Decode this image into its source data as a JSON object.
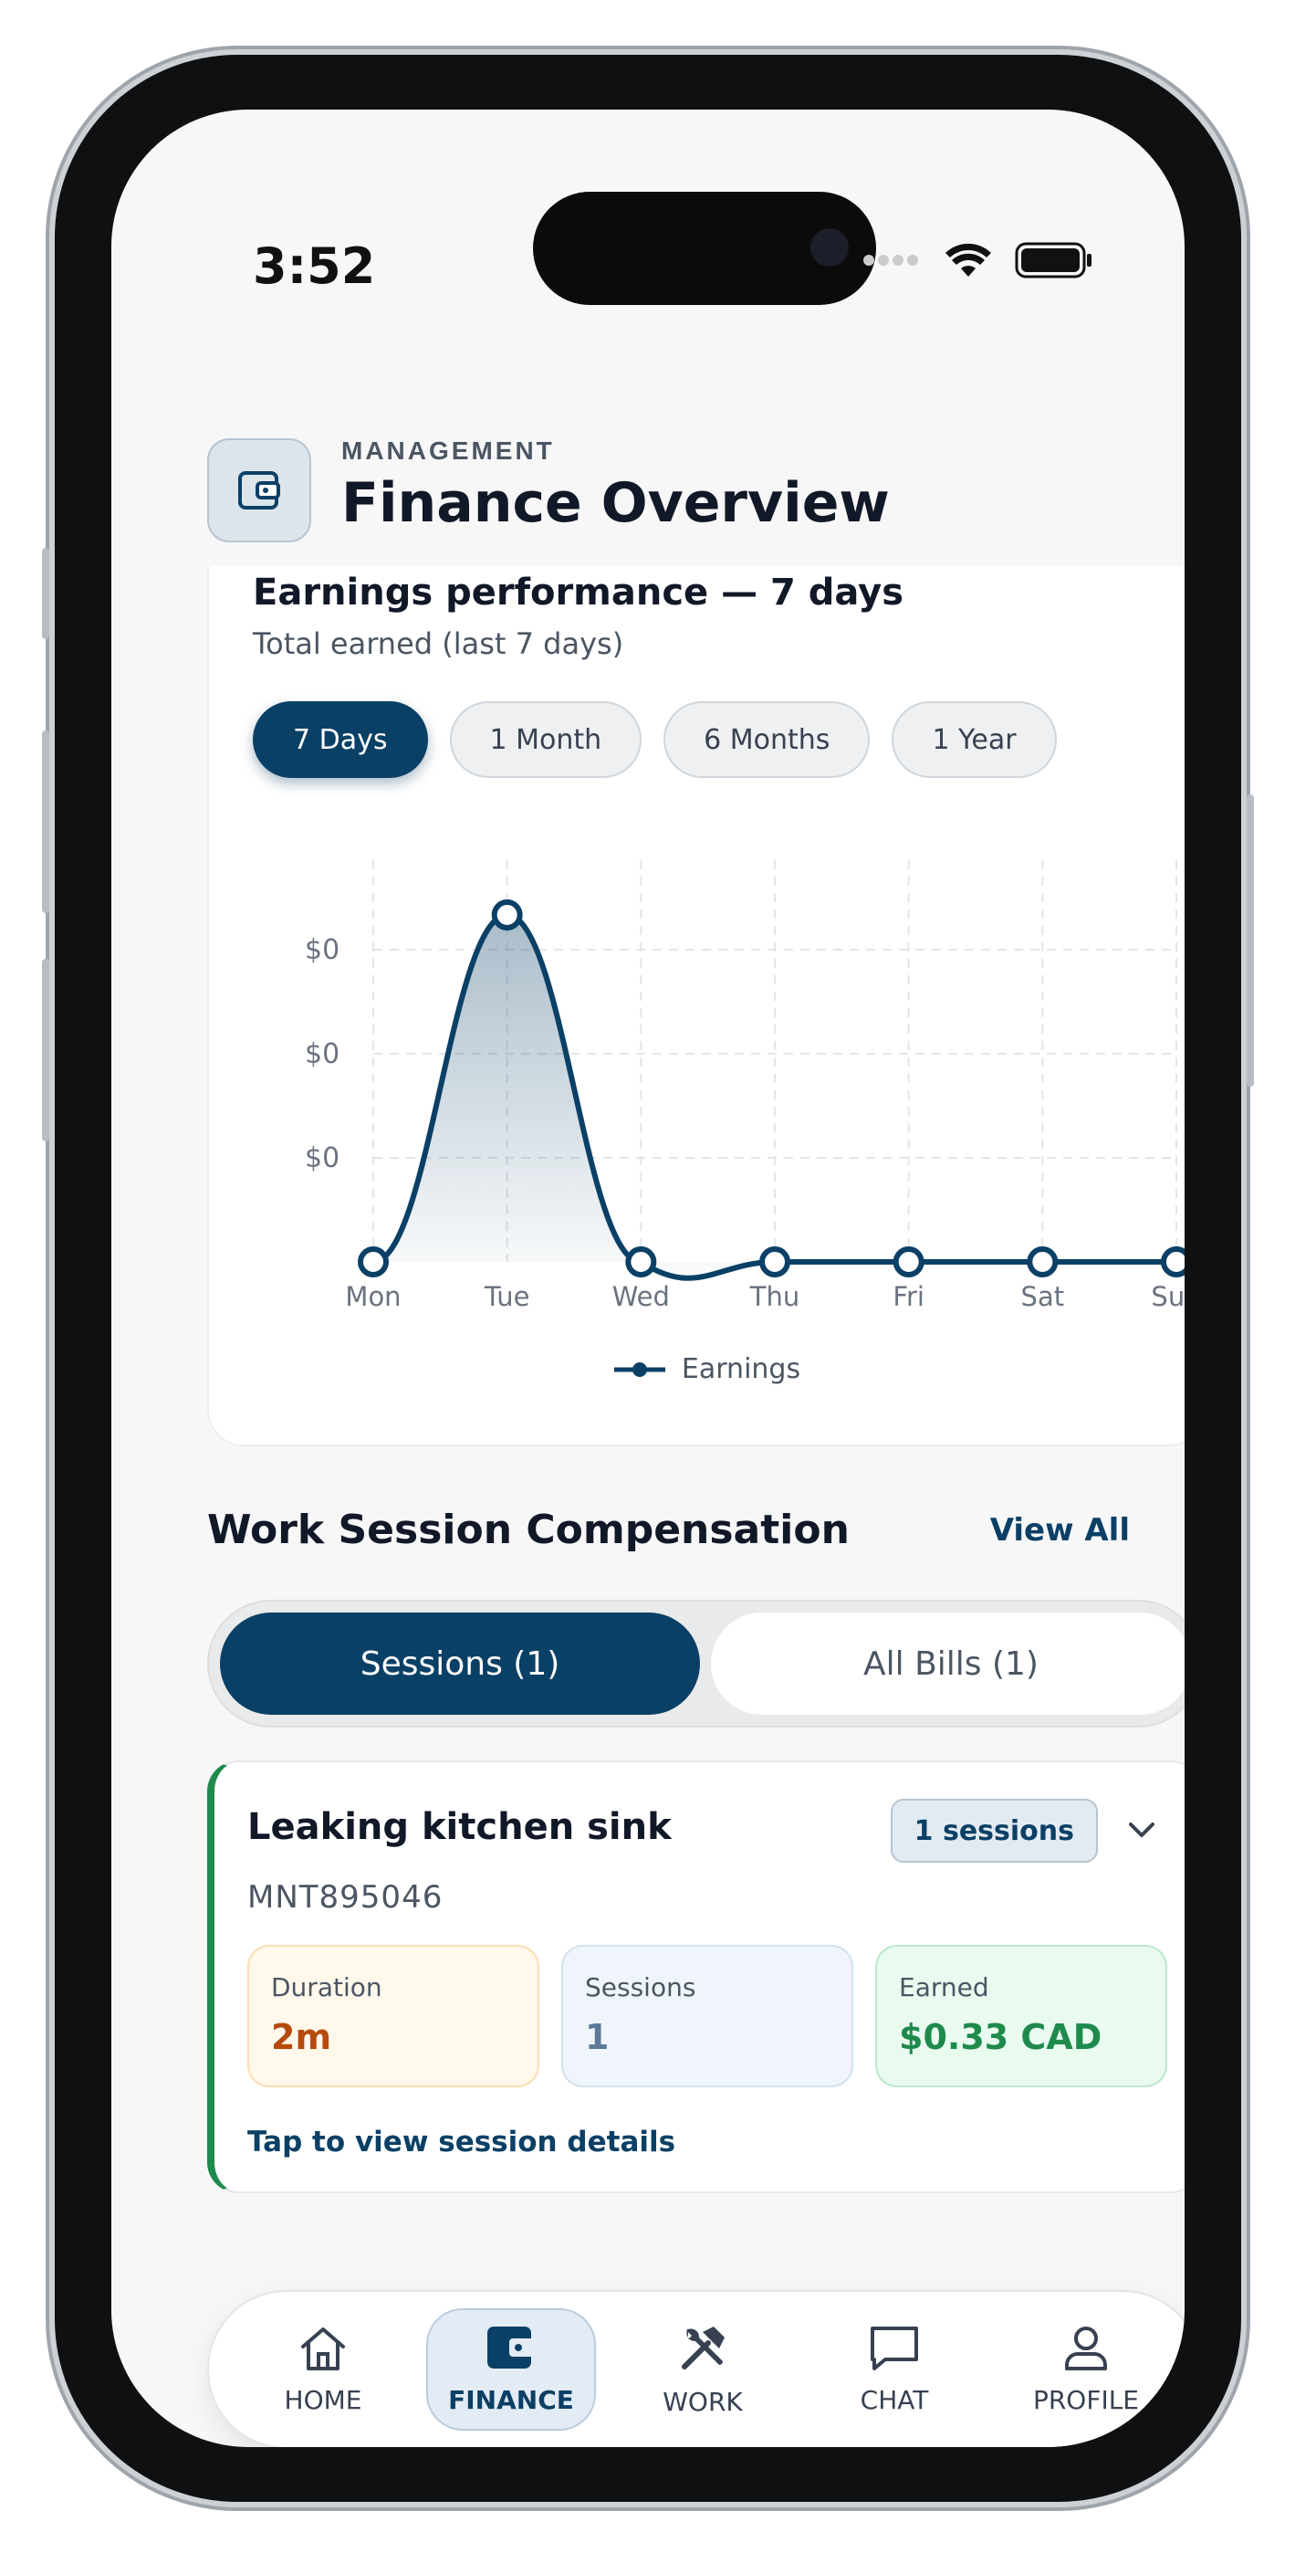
{
  "status": {
    "time": "3:52"
  },
  "header": {
    "subtitle": "MANAGEMENT",
    "title": "Finance Overview",
    "icon": "wallet-icon"
  },
  "earnings_card": {
    "title": "Earnings performance — 7 days",
    "subtitle": "Total earned (last 7 days)",
    "tabs": [
      "7 Days",
      "1 Month",
      "6 Months",
      "1 Year"
    ],
    "active_tab": "7 Days",
    "legend": "Earnings"
  },
  "chart_data": {
    "type": "line",
    "categories": [
      "Mon",
      "Tue",
      "Wed",
      "Thu",
      "Fri",
      "Sat",
      "Sun"
    ],
    "series": [
      {
        "name": "Earnings",
        "values": [
          0,
          0.33,
          0,
          0,
          0,
          0,
          0
        ]
      }
    ],
    "y_tick_labels": [
      "$0",
      "$0",
      "$0"
    ],
    "ylim": [
      0,
      0.33
    ],
    "grid": true,
    "legend": "bottom-center",
    "color": "#0b4066"
  },
  "compensation": {
    "title": "Work Session Compensation",
    "view_all": "View All",
    "segments": {
      "sessions": "Sessions (1)",
      "bills": "All Bills (1)"
    }
  },
  "session": {
    "title": "Leaking kitchen sink",
    "badge": "1 sessions",
    "code": "MNT895046",
    "duration_label": "Duration",
    "duration_value": "2m",
    "sessions_label": "Sessions",
    "sessions_value": "1",
    "earned_label": "Earned",
    "earned_value": "$0.33 CAD",
    "link": "Tap to view session details"
  },
  "nav": {
    "home": "HOME",
    "finance": "FINANCE",
    "work": "WORK",
    "chat": "CHAT",
    "profile": "PROFILE",
    "active": "FINANCE"
  },
  "colors": {
    "primary": "#0b4066",
    "success": "#1e8a4c",
    "warning": "#b64a0b"
  }
}
